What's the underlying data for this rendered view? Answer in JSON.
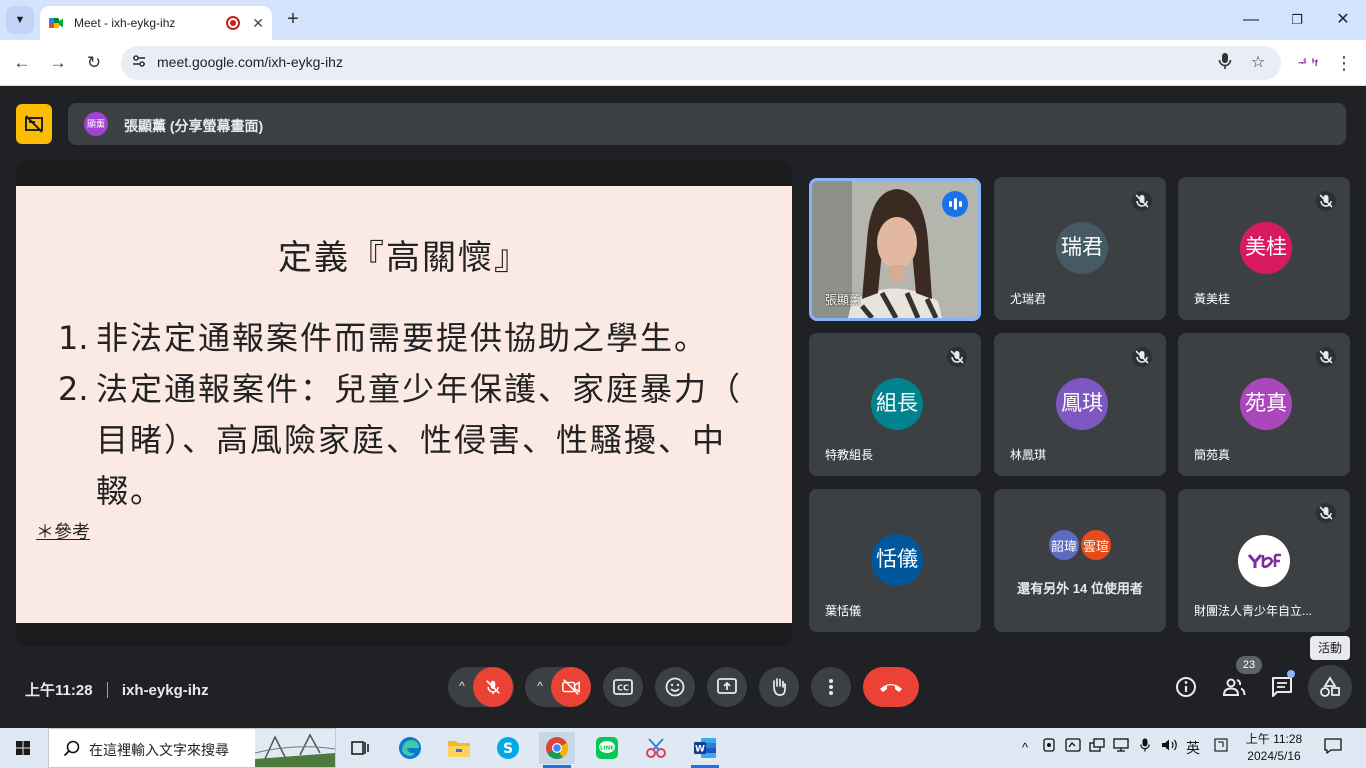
{
  "browser": {
    "tab_title": "Meet - ixh-eykg-ihz",
    "url": "meet.google.com/ixh-eykg-ihz",
    "extension_label": "ᅻᅡf"
  },
  "presenter": {
    "avatar_initials": "顯薰",
    "text": "張顯薰 (分享螢幕畫面)"
  },
  "slide": {
    "title": "定義『高關懷』",
    "items": [
      {
        "number": "1.",
        "lines": [
          "非法定通報案件而需要提供協助之學生。"
        ]
      },
      {
        "number": "2.",
        "lines": [
          "法定通報案件：兒童少年保護、家庭暴力（",
          "目睹）、高風險家庭、性侵害、性騷擾、中",
          "輟。"
        ]
      }
    ],
    "reference": "＊參考"
  },
  "participants": [
    {
      "name": "張顯薰",
      "avatar": "",
      "color": "",
      "speaking": true,
      "video": true
    },
    {
      "name": "尤瑞君",
      "avatar": "瑞君",
      "color": "#455a64",
      "muted": true
    },
    {
      "name": "黃美桂",
      "avatar": "美桂",
      "color": "#d81b60",
      "muted": true
    },
    {
      "name": "特教組長",
      "avatar": "組長",
      "color": "#00838f",
      "muted": true
    },
    {
      "name": "林鳳琪",
      "avatar": "鳳琪",
      "color": "#7e57c2",
      "muted": true
    },
    {
      "name": "簡苑真",
      "avatar": "苑真",
      "color": "#ab47bc",
      "muted": true
    },
    {
      "name": "葉恬儀",
      "avatar": "恬儀",
      "color": "#01579b",
      "muted": false
    },
    {
      "name": "還有另外 14 位使用者",
      "avatars": [
        {
          "label": "韶瑋",
          "color": "#5c6bc0"
        },
        {
          "label": "雲瑄",
          "color": "#e64a19"
        }
      ]
    },
    {
      "name": "財團法人青少年自立...",
      "muted": true,
      "logo": true
    }
  ],
  "controls": {
    "time": "上午11:28",
    "meeting_code": "ixh-eykg-ihz",
    "people_count": "23",
    "activity_tooltip": "活動"
  },
  "taskbar": {
    "search_placeholder": "在這裡輸入文字來搜尋",
    "ime": "英",
    "clock_time": "上午 11:28",
    "clock_date": "2024/5/16"
  },
  "colors": {
    "meet_bg": "#202124",
    "tile_bg": "#3c4043",
    "red": "#ea4335",
    "present_yellow": "#fbbc04",
    "slide_bg": "#fbe9e4"
  }
}
